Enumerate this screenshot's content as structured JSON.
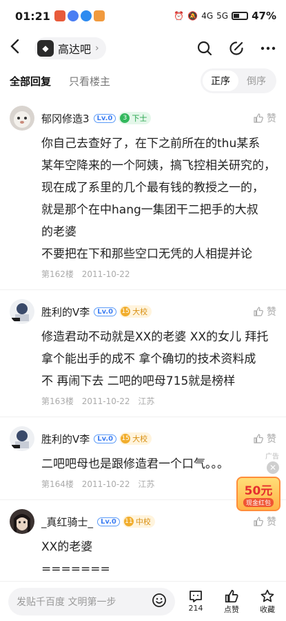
{
  "status": {
    "time": "01:21",
    "net": "4G",
    "net2": "5G",
    "battery": "47%"
  },
  "header": {
    "forum_name": "高达吧"
  },
  "tabs": {
    "all": "全部回复",
    "op_only": "只看楼主",
    "sort_asc": "正序",
    "sort_desc": "倒序"
  },
  "posts": [
    {
      "username": "郁冈修造3",
      "level": "Lv.0",
      "badge_num": "3",
      "badge": "下士",
      "like": "赞",
      "lines": [
        "你自己去查好了，在下之前所在的thu某系",
        "某年空降来的一个阿姨，搞飞控相关研究的，",
        "现在成了系里的几个最有钱的教授之一的，",
        "就是那个在中hang一集团干二把手的大叔",
        "的老婆",
        "不要把在下和那些空口无凭的人相提并论"
      ],
      "floor": "第162楼",
      "date": "2011-10-22",
      "location": ""
    },
    {
      "username": "胜利的V李",
      "level": "Lv.0",
      "badge_num": "15",
      "badge": "大校",
      "like": "赞",
      "lines": [
        "修造君动不动就是XX的老婆 XX的女儿 拜托",
        "拿个能出手的成不 拿个确切的技术资料成",
        "不 再闹下去 二吧的吧母715就是榜样"
      ],
      "floor": "第163楼",
      "date": "2011-10-22",
      "location": "江苏"
    },
    {
      "username": "胜利的V李",
      "level": "Lv.0",
      "badge_num": "15",
      "badge": "大校",
      "like": "赞",
      "lines": [
        "二吧吧母也是跟修造君一个口气。。。"
      ],
      "floor": "第164楼",
      "date": "2011-10-22",
      "location": "江苏"
    },
    {
      "username": "_真红骑士_",
      "level": "Lv.0",
      "badge_num": "11",
      "badge": "中校",
      "like": "赞",
      "lines": [
        "XX的老婆",
        "======="
      ],
      "floor": "",
      "date": "",
      "location": ""
    }
  ],
  "ad": {
    "label": "广告",
    "amount": "50元",
    "caption": "现金红包"
  },
  "bottom": {
    "placeholder": "发贴千百度 文明第一步",
    "comments": "214",
    "like": "点赞",
    "fav": "收藏"
  },
  "colors": {
    "accent": "#3d7ef2",
    "green_badge": "#33b85d",
    "gold_badge": "#f1ad2c"
  }
}
